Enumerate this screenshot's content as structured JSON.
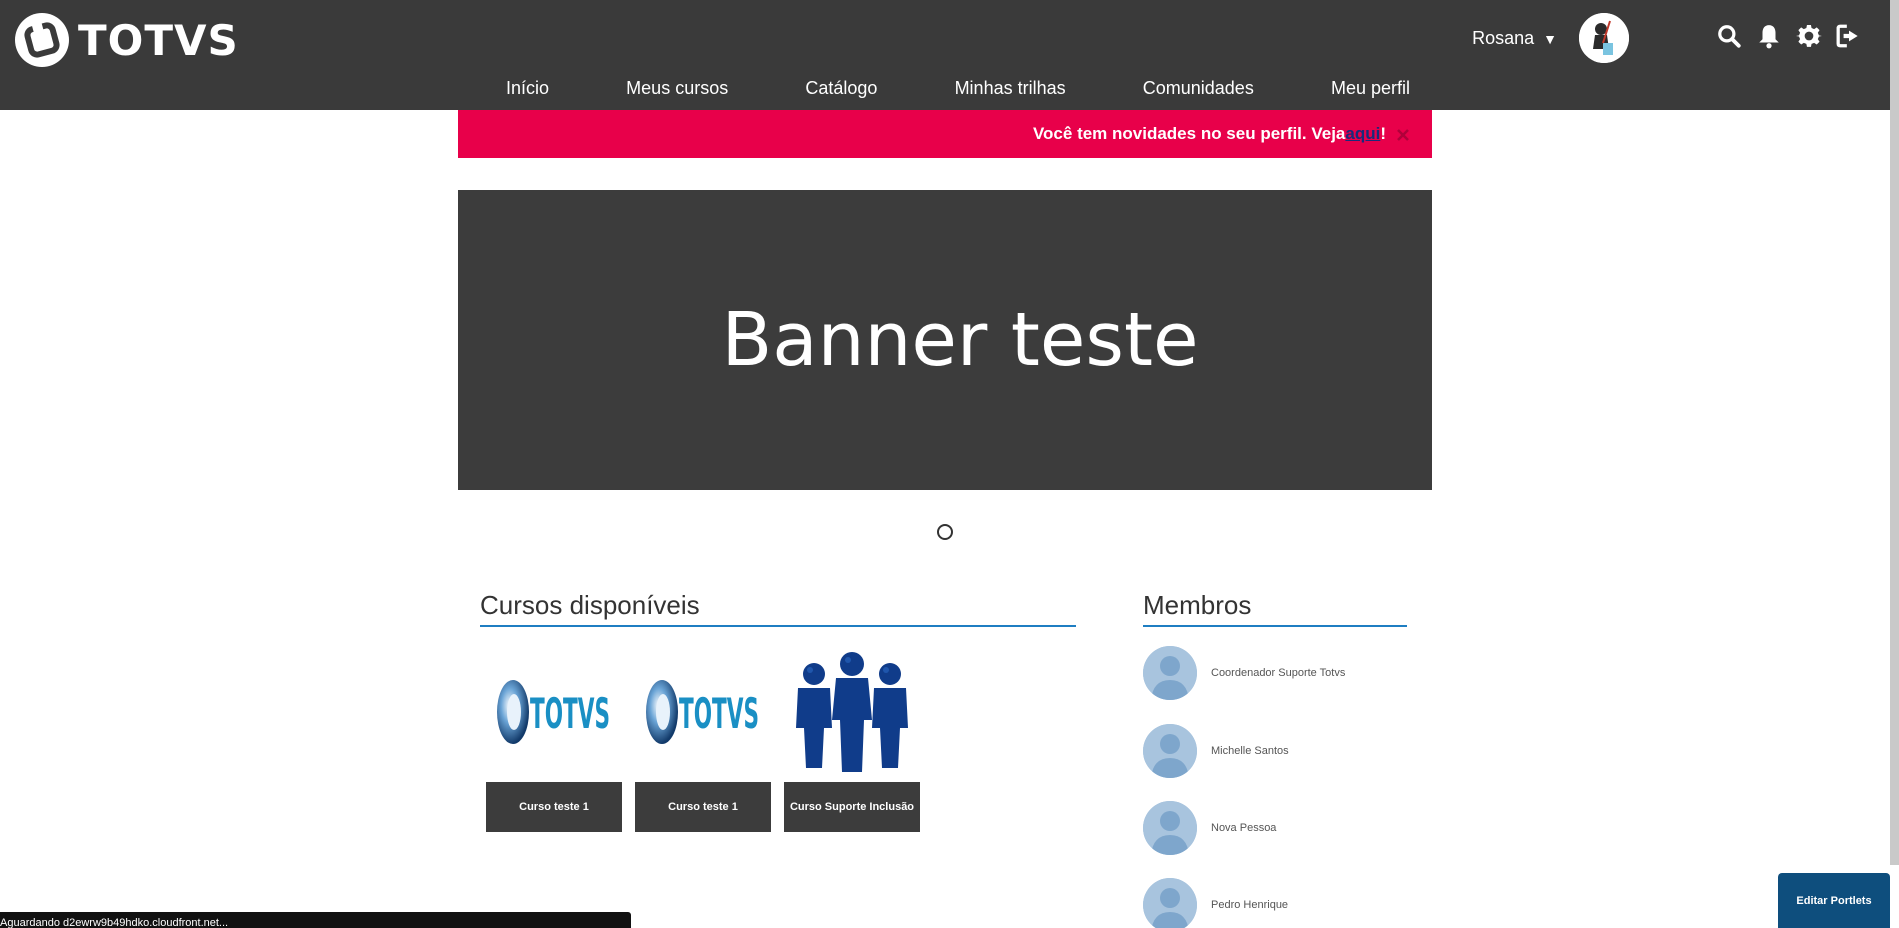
{
  "header": {
    "logo_text": "TOTVS",
    "user_name": "Rosana",
    "user_caret": "▼",
    "icons": [
      "search-icon",
      "bell-icon",
      "gear-icon",
      "logout-icon"
    ]
  },
  "nav": {
    "items": [
      {
        "label": "Início"
      },
      {
        "label": "Meus cursos"
      },
      {
        "label": "Catálogo"
      },
      {
        "label": "Minhas trilhas"
      },
      {
        "label": "Comunidades"
      },
      {
        "label": "Meu perfil"
      }
    ]
  },
  "notice": {
    "text_before": "Você tem novidades no seu perfil. Veja ",
    "link": "aqui",
    "text_after": "!",
    "color": "#e8004a"
  },
  "banner": {
    "title": "Banner teste"
  },
  "courses": {
    "title": "Cursos disponíveis",
    "items": [
      {
        "label": "Curso teste 1",
        "image": "totvs-logo"
      },
      {
        "label": "Curso teste 1",
        "image": "totvs-logo"
      },
      {
        "label": "Curso Suporte Inclusão",
        "image": "people-group"
      }
    ]
  },
  "members": {
    "title": "Membros",
    "items": [
      {
        "name": "Coordenador Suporte Totvs"
      },
      {
        "name": "Michelle Santos"
      },
      {
        "name": "Nova Pessoa"
      },
      {
        "name": "Pedro Henrique"
      }
    ]
  },
  "edit_portlets": "Editar Portlets",
  "status_bar": "Aguardando d2ewrw9b49hdko.cloudfront.net..."
}
